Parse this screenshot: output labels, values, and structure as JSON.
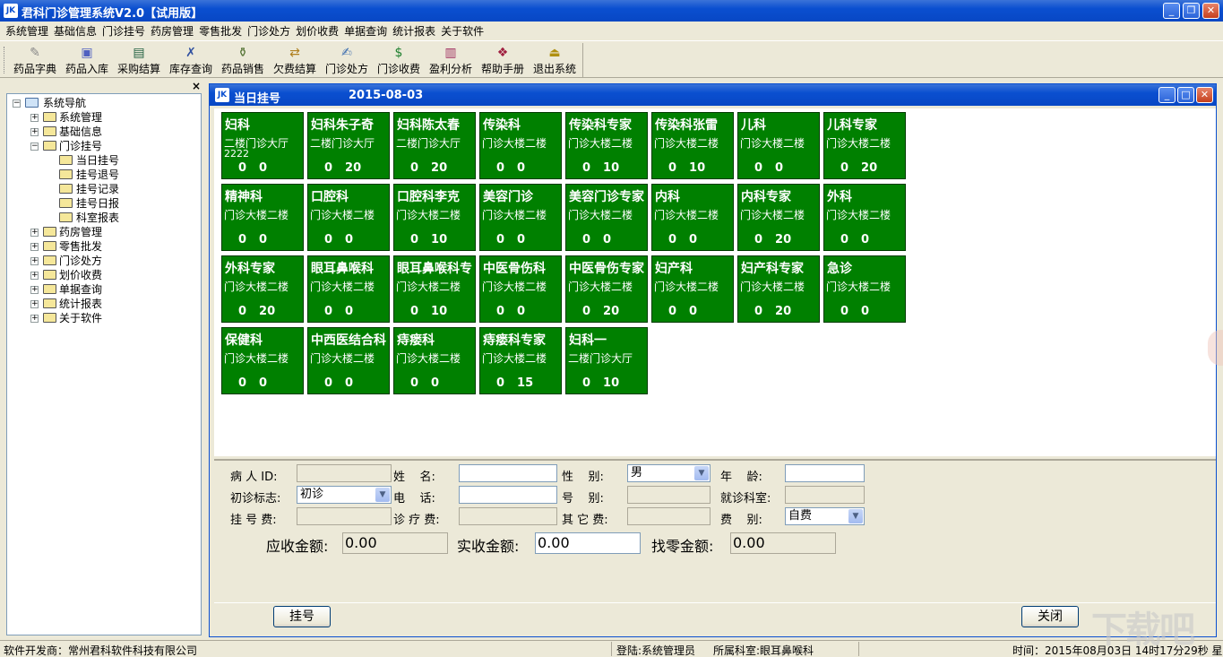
{
  "app": {
    "title": "君科门诊管理系统V2.0【试用版】",
    "icon": "app-icon"
  },
  "menu": [
    "系统管理",
    "基础信息",
    "门诊挂号",
    "药房管理",
    "零售批发",
    "门诊处方",
    "划价收费",
    "单据查询",
    "统计报表",
    "关于软件"
  ],
  "toolbar": [
    {
      "label": "药品字典",
      "icon": "drug-dictionary-icon"
    },
    {
      "label": "药品入库",
      "icon": "stock-in-icon"
    },
    {
      "label": "采购结算",
      "icon": "purchase-settle-icon"
    },
    {
      "label": "库存查询",
      "icon": "inventory-query-icon"
    },
    {
      "label": "药品销售",
      "icon": "drug-sales-icon"
    },
    {
      "label": "欠费结算",
      "icon": "arrears-icon"
    },
    {
      "label": "门诊处方",
      "icon": "prescription-icon"
    },
    {
      "label": "门诊收费",
      "icon": "charge-icon"
    },
    {
      "label": "盈利分析",
      "icon": "profit-chart-icon"
    },
    {
      "label": "帮助手册",
      "icon": "help-book-icon"
    },
    {
      "label": "退出系统",
      "icon": "exit-icon"
    }
  ],
  "nav": {
    "close": "×",
    "root": "系统导航",
    "items": [
      "系统管理",
      "基础信息",
      "门诊挂号",
      "当日挂号",
      "挂号退号",
      "挂号记录",
      "挂号日报",
      "科室报表",
      "药房管理",
      "零售批发",
      "门诊处方",
      "划价收费",
      "单据查询",
      "统计报表",
      "关于软件"
    ]
  },
  "child": {
    "title": "当日挂号",
    "date": "2015-08-03",
    "min": "_",
    "max": "□",
    "close": "×"
  },
  "tiles": [
    {
      "name": "妇科",
      "loc": "二楼门诊大厅",
      "extra": "2222",
      "a": "0",
      "b": "0"
    },
    {
      "name": "妇科朱子奇",
      "loc": "二楼门诊大厅",
      "extra": "",
      "a": "0",
      "b": "20"
    },
    {
      "name": "妇科陈太春",
      "loc": "二楼门诊大厅",
      "extra": "",
      "a": "0",
      "b": "20"
    },
    {
      "name": "传染科",
      "loc": "门诊大楼二楼",
      "extra": "",
      "a": "0",
      "b": "0"
    },
    {
      "name": "传染科专家",
      "loc": "门诊大楼二楼",
      "extra": "",
      "a": "0",
      "b": "10"
    },
    {
      "name": "传染科张雷",
      "loc": "门诊大楼二楼",
      "extra": "",
      "a": "0",
      "b": "10"
    },
    {
      "name": "儿科",
      "loc": "门诊大楼二楼",
      "extra": "",
      "a": "0",
      "b": "0"
    },
    {
      "name": "儿科专家",
      "loc": "门诊大楼二楼",
      "extra": "",
      "a": "0",
      "b": "20"
    },
    {
      "name": "精神科",
      "loc": "门诊大楼二楼",
      "extra": "",
      "a": "0",
      "b": "0"
    },
    {
      "name": "口腔科",
      "loc": "门诊大楼二楼",
      "extra": "",
      "a": "0",
      "b": "0"
    },
    {
      "name": "口腔科李克",
      "loc": "门诊大楼二楼",
      "extra": "",
      "a": "0",
      "b": "10"
    },
    {
      "name": "美容门诊",
      "loc": "门诊大楼二楼",
      "extra": "",
      "a": "0",
      "b": "0"
    },
    {
      "name": "美容门诊专家",
      "loc": "门诊大楼二楼",
      "extra": "",
      "a": "0",
      "b": "0"
    },
    {
      "name": "内科",
      "loc": "门诊大楼二楼",
      "extra": "",
      "a": "0",
      "b": "0"
    },
    {
      "name": "内科专家",
      "loc": "门诊大楼二楼",
      "extra": "",
      "a": "0",
      "b": "20"
    },
    {
      "name": "外科",
      "loc": "门诊大楼二楼",
      "extra": "",
      "a": "0",
      "b": "0"
    },
    {
      "name": "外科专家",
      "loc": "门诊大楼二楼",
      "extra": "",
      "a": "0",
      "b": "20"
    },
    {
      "name": "眼耳鼻喉科",
      "loc": "门诊大楼二楼",
      "extra": "",
      "a": "0",
      "b": "0"
    },
    {
      "name": "眼耳鼻喉科专",
      "loc": "门诊大楼二楼",
      "extra": "",
      "a": "0",
      "b": "10"
    },
    {
      "name": "中医骨伤科",
      "loc": "门诊大楼二楼",
      "extra": "",
      "a": "0",
      "b": "0"
    },
    {
      "name": "中医骨伤专家",
      "loc": "门诊大楼二楼",
      "extra": "",
      "a": "0",
      "b": "20"
    },
    {
      "name": "妇产科",
      "loc": "门诊大楼二楼",
      "extra": "",
      "a": "0",
      "b": "0"
    },
    {
      "name": "妇产科专家",
      "loc": "门诊大楼二楼",
      "extra": "",
      "a": "0",
      "b": "20"
    },
    {
      "name": "急诊",
      "loc": "门诊大楼二楼",
      "extra": "",
      "a": "0",
      "b": "0"
    },
    {
      "name": "保健科",
      "loc": "门诊大楼二楼",
      "extra": "",
      "a": "0",
      "b": "0"
    },
    {
      "name": "中西医结合科",
      "loc": "门诊大楼二楼",
      "extra": "",
      "a": "0",
      "b": "0"
    },
    {
      "name": "痔瘘科",
      "loc": "门诊大楼二楼",
      "extra": "",
      "a": "0",
      "b": "0"
    },
    {
      "name": "痔瘘科专家",
      "loc": "门诊大楼二楼",
      "extra": "",
      "a": "0",
      "b": "15"
    },
    {
      "name": "妇科一",
      "loc": "二楼门诊大厅",
      "extra": "",
      "a": "0",
      "b": "10"
    }
  ],
  "form": {
    "patient_id_label": "病 人 ID:",
    "name_label": "姓    名:",
    "gender_label": "性    别:",
    "gender_value": "男",
    "age_label": "年    龄:",
    "visit_flag_label": "初诊标志:",
    "visit_flag_value": "初诊",
    "phone_label": "电    话:",
    "number_type_label": "号    别:",
    "dept_label": "就诊科室:",
    "reg_fee_label": "挂 号 费:",
    "treat_fee_label": "诊 疗 费:",
    "other_fee_label": "其 它 费:",
    "fee_type_label": "费    别:",
    "fee_type_value": "自费",
    "receivable_label": "应收金额:",
    "receivable_value": "0.00",
    "received_label": "实收金额:",
    "received_value": "0.00",
    "change_label": "找零金额:",
    "change_value": "0.00"
  },
  "buttons": {
    "register": "挂号",
    "close": "关闭"
  },
  "status": {
    "developer": "软件开发商：常州君科软件科技有限公司",
    "login": "登陆:系统管理员",
    "dept": "所属科室:眼耳鼻喉科",
    "time": "时间：2015年08月03日  14时17分29秒  星期一"
  },
  "watermark": "下载吧",
  "colors": {
    "tile_green": "#008000",
    "titlebar_blue": "#0a4fd0"
  }
}
